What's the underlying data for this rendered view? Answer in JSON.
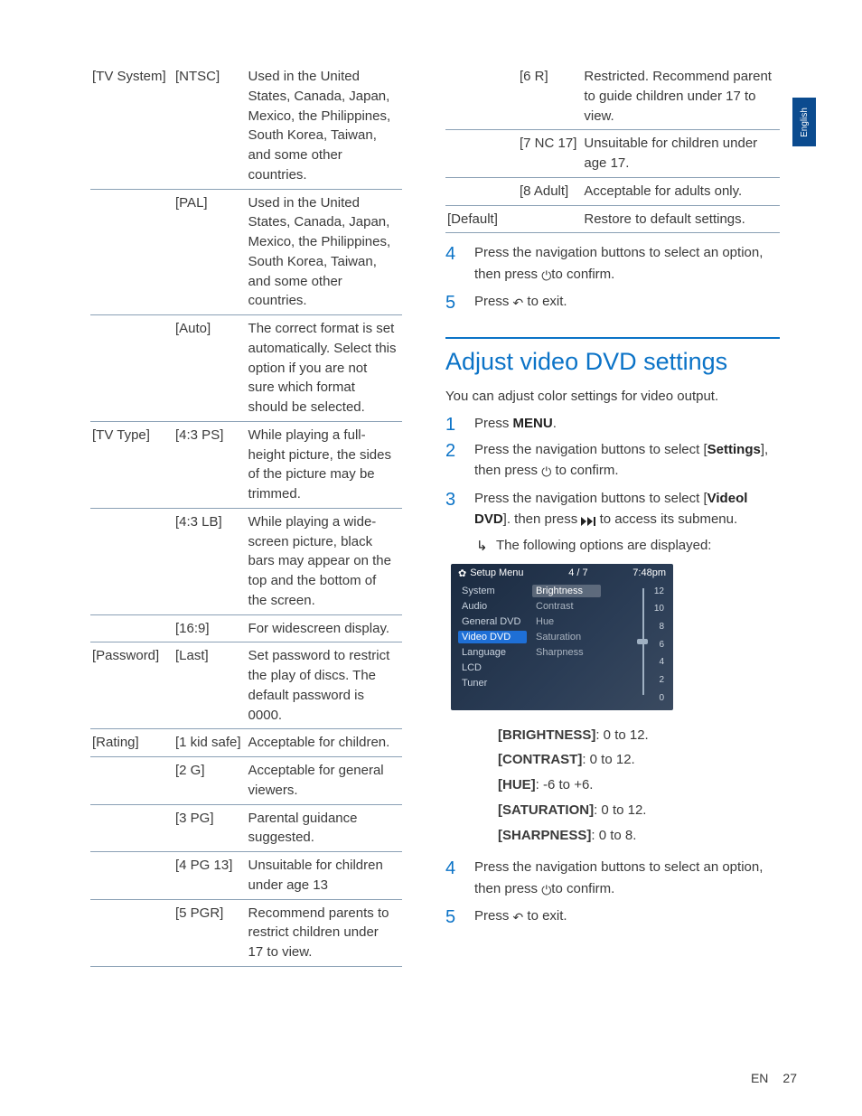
{
  "language_tab": "English",
  "left_table": [
    {
      "c1": "[TV System]",
      "c2": "[NTSC]",
      "c3": "Used in the United States, Canada, Japan, Mexico, the Philippines, South Korea, Taiwan, and some other countries."
    },
    {
      "c1": "",
      "c2": "[PAL]",
      "c3": "Used in the United States, Canada, Japan, Mexico, the Philippines, South Korea, Taiwan, and some other countries."
    },
    {
      "c1": "",
      "c2": "[Auto]",
      "c3": "The correct format is set automatically. Select this option if you are not sure which format should be selected."
    },
    {
      "c1": "[TV Type]",
      "c2": "[4:3 PS]",
      "c3": "While playing a full-height picture, the sides of the picture may be trimmed."
    },
    {
      "c1": "",
      "c2": "[4:3 LB]",
      "c3": "While playing a wide-screen picture, black bars may appear on the top and the bottom of the screen."
    },
    {
      "c1": "",
      "c2": "[16:9]",
      "c3": "For widescreen display."
    },
    {
      "c1": "[Password]",
      "c2": "[Last]",
      "c3": "Set password to restrict the play of discs. The default password is 0000."
    },
    {
      "c1": "[Rating]",
      "c2": "[1 kid safe]",
      "c3": "Acceptable for children."
    },
    {
      "c1": "",
      "c2": "[2 G]",
      "c3": "Acceptable for general viewers."
    },
    {
      "c1": "",
      "c2": "[3 PG]",
      "c3": "Parental guidance suggested."
    },
    {
      "c1": "",
      "c2": "[4 PG 13]",
      "c3": "Unsuitable for children under age 13"
    },
    {
      "c1": "",
      "c2": "[5 PGR]",
      "c3": "Recommend parents to restrict children under 17 to view."
    }
  ],
  "right_table": [
    {
      "c1": "",
      "c2": "[6 R]",
      "c3": "Restricted. Recommend parent to guide children under 17 to view."
    },
    {
      "c1": "",
      "c2": "[7 NC 17]",
      "c3": "Unsuitable for children under age 17."
    },
    {
      "c1": "",
      "c2": "[8 Adult]",
      "c3": "Acceptable for adults only."
    },
    {
      "c1": "[Default]",
      "c2": "",
      "c3": "Restore to default settings."
    }
  ],
  "steps_a": {
    "s4_a": "Press the navigation buttons to select an option, then press ",
    "s4_b": "to confirm.",
    "s5_a": "Press ",
    "s5_b": " to exit."
  },
  "heading": "Adjust video DVD settings",
  "intro": "You can adjust color settings for video output.",
  "steps_b": {
    "s1_a": "Press ",
    "s1_menu": "MENU",
    "s1_b": ".",
    "s2_a": "Press the navigation buttons to select [",
    "s2_settings": "Settings",
    "s2_b": "], then press ",
    "s2_c": " to confirm.",
    "s3_a": "Press the navigation buttons to select [",
    "s3_video": "Videol DVD",
    "s3_b": "]. then press ",
    "s3_c": " to access its submenu.",
    "s3_sub": "The following options are displayed:"
  },
  "mock": {
    "title": "Setup Menu",
    "pager": "4 / 7",
    "time": "7:48pm",
    "left": [
      "System",
      "Audio",
      "General DVD",
      "Video DVD",
      "Language",
      "LCD",
      "Tuner"
    ],
    "left_selected_index": 3,
    "mid": [
      "Brightness",
      "Contrast",
      "Hue",
      "Saturation",
      "Sharpness"
    ],
    "mid_selected_index": 0,
    "scale_ticks": [
      "12",
      "10",
      "8",
      "6",
      "4",
      "2",
      "0"
    ],
    "knob_index": 3
  },
  "opt_list": [
    {
      "lbl": "[BRIGHTNESS]",
      "val": ": 0 to 12."
    },
    {
      "lbl": "[CONTRAST]",
      "val": ": 0 to 12."
    },
    {
      "lbl": "[HUE]",
      "val": ": -6 to +6."
    },
    {
      "lbl": "[SATURATION]",
      "val": ": 0 to 12."
    },
    {
      "lbl": "[SHARPNESS]",
      "val": ": 0 to 8."
    }
  ],
  "steps_c": {
    "s4_a": "Press the navigation buttons to select an option, then press ",
    "s4_b": "to confirm.",
    "s5_a": "Press ",
    "s5_b": " to exit."
  },
  "footer": {
    "lang": "EN",
    "page": "27"
  }
}
